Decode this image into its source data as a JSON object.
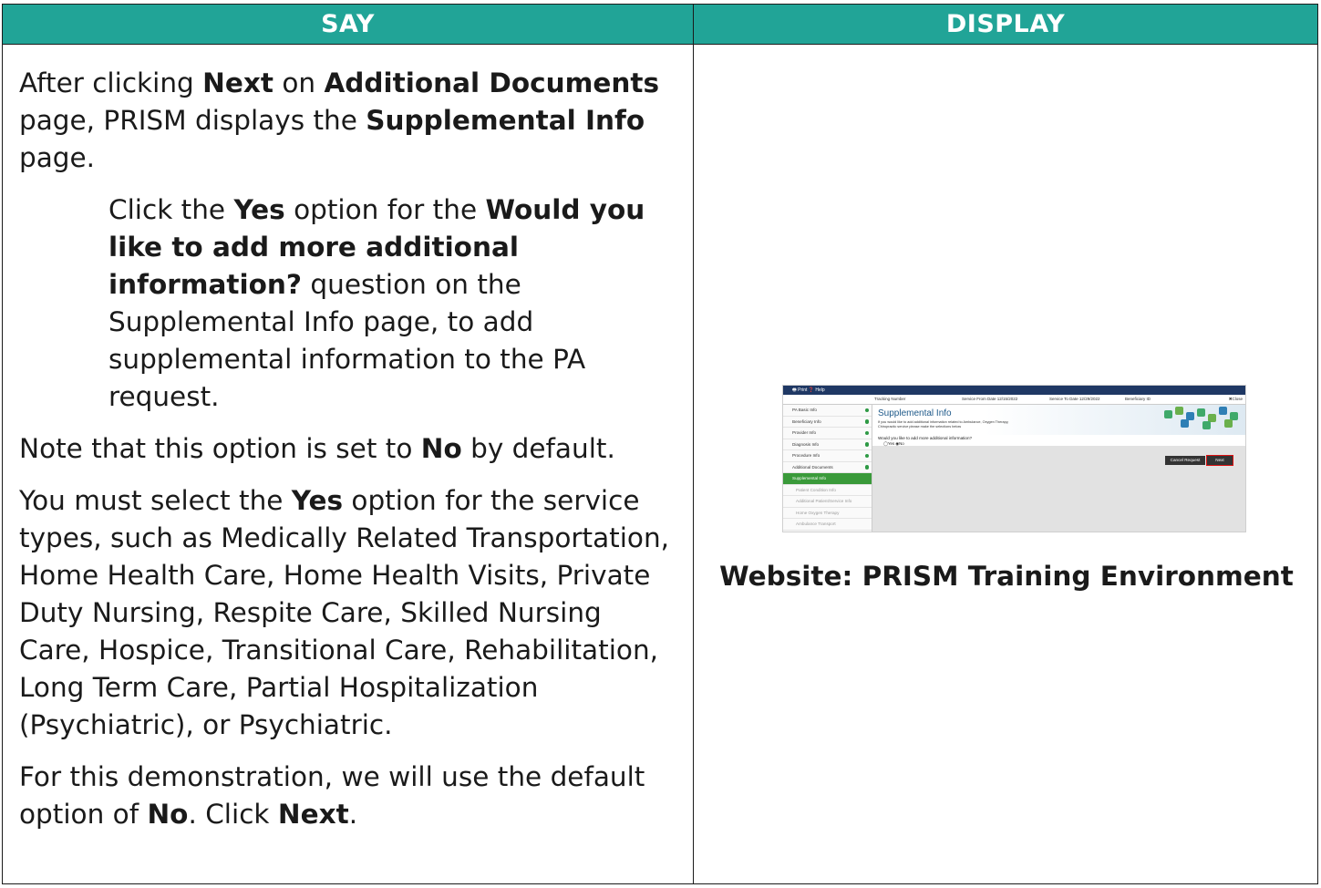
{
  "headers": {
    "say": "SAY",
    "display": "DISPLAY"
  },
  "say": {
    "p1": {
      "a": "After clicking ",
      "b": "Next",
      "c": " on ",
      "d": "Additional Documents",
      "e": " page, PRISM displays the ",
      "f": "Supplemental Info",
      "g": " page."
    },
    "p2": {
      "a": "Click the ",
      "b": "Yes",
      "c": " option for the ",
      "d": "Would you like to add more additional information?",
      "e": " question on the Supplemental Info page, to add supplemental information to the PA request."
    },
    "p3": {
      "a": "Note that this option is set to ",
      "b": "No",
      "c": " by default."
    },
    "p4": {
      "a": "You must select the ",
      "b": "Yes",
      "c": " option for the service types, such as Medically Related Transportation, Home Health Care, Home Health Visits, Private Duty Nursing, Respite Care, Skilled Nursing Care, Hospice, Transitional Care, Rehabilitation, Long Term Care, Partial Hospitalization (Psychiatric), or Psychiatric."
    },
    "p5": {
      "a": "For this demonstration, we will use the default option of ",
      "b": "No",
      "c": ". Click ",
      "d": "Next",
      "e": "."
    }
  },
  "screenshot": {
    "topbar": "🖶 Print  ❓ Help",
    "tracking": "Tracking Number",
    "from": "Service From Date 12/15/2022",
    "to": "Service To Date 12/29/2022",
    "beneficiary": "Beneficiary ID",
    "close": "✖Close",
    "nav": [
      "PA Basic Info",
      "Beneficiary Info",
      "Provider Info",
      "Diagnosis Info",
      "Procedure Info",
      "Additional Documents"
    ],
    "active": "Supplemental Info",
    "subnav": [
      "Patient Condition Info",
      "Additional Patient/Service Info",
      "Home Oxygen Therapy",
      "Ambulance Transport"
    ],
    "title": "Supplemental Info",
    "description": "If you would like to add additional information related to Ambulance, Oxygen Therapy, Chiropractic service please make the selections below",
    "question": "Would you like to add more additional information?",
    "radio": "◯Yes ◉No",
    "cancel": "Cancel Request",
    "next": "Next"
  },
  "caption": "Website: PRISM Training Environment"
}
